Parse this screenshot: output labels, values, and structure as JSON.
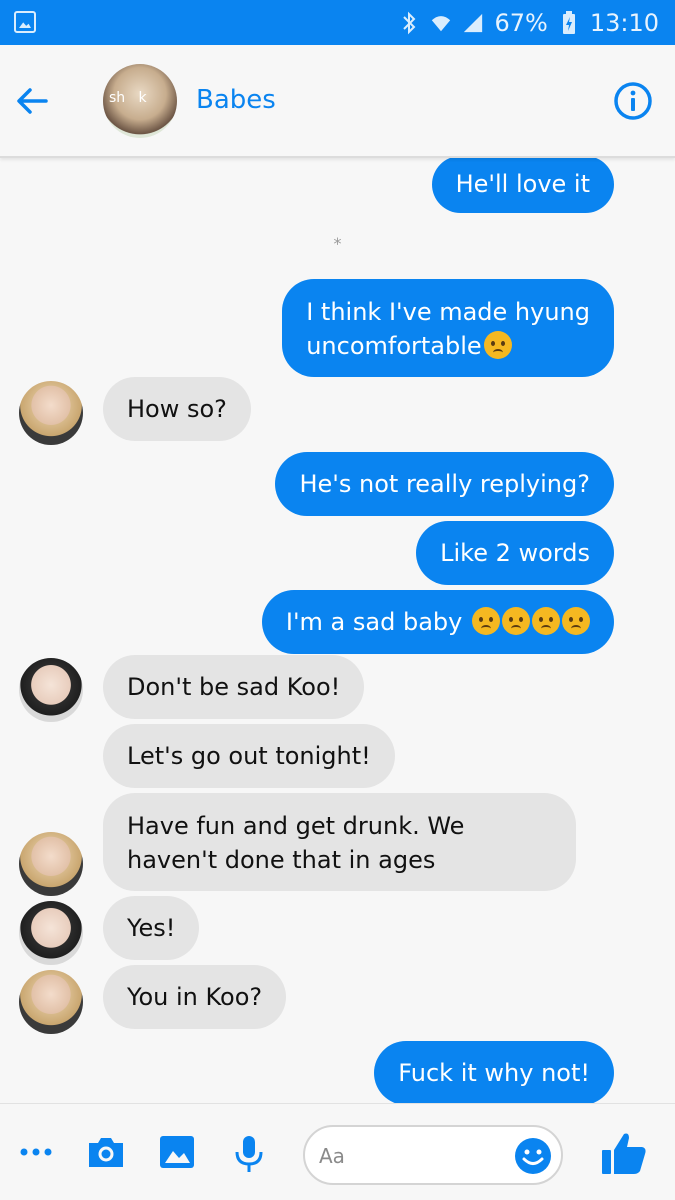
{
  "status_bar": {
    "battery": "67%",
    "time": "13:10"
  },
  "header": {
    "title": "Babes",
    "avatar_overlay_text": "sh   k"
  },
  "timestamp": "*",
  "messages": [
    {
      "side": "out",
      "text": "He'll love it"
    },
    {
      "side": "out",
      "text": "I think I've made hyung\nuncomfortable",
      "emoji_count": 1
    },
    {
      "side": "in",
      "text": "How so?",
      "avatar": "a"
    },
    {
      "side": "out",
      "text": "He's not really replying?"
    },
    {
      "side": "out",
      "text": "Like 2 words"
    },
    {
      "side": "out",
      "text": "I'm a sad baby",
      "emoji_count": 4
    },
    {
      "side": "in",
      "text": "Don't be sad Koo!",
      "avatar": "b"
    },
    {
      "side": "in",
      "text": "Let's go out tonight!"
    },
    {
      "side": "in",
      "text": "Have fun and get drunk. We\nhaven't done that in ages",
      "avatar": "a"
    },
    {
      "side": "in",
      "text": "Yes!",
      "avatar": "b"
    },
    {
      "side": "in",
      "text": "You in Koo?",
      "avatar": "a"
    },
    {
      "side": "out",
      "text": "Fuck it why not!"
    }
  ],
  "composer": {
    "placeholder": "Aa"
  },
  "colors": {
    "accent": "#0a84f0",
    "incoming_bubble": "#e4e4e4",
    "background": "#f7f7f7"
  },
  "icons": [
    "back-arrow-icon",
    "info-icon",
    "more-icon",
    "camera-icon",
    "gallery-icon",
    "microphone-icon",
    "emoji-icon",
    "thumbs-up-icon"
  ]
}
